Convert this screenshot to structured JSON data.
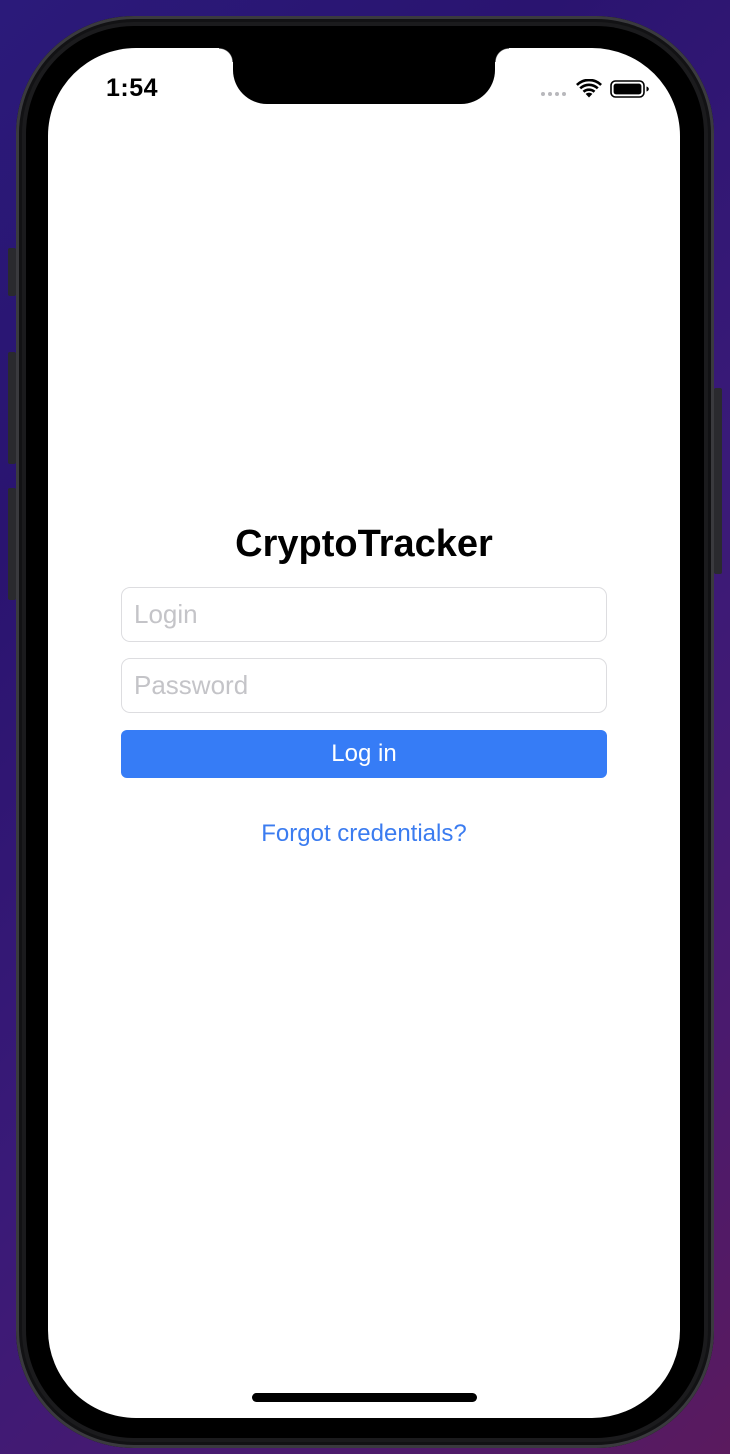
{
  "status_bar": {
    "time": "1:54",
    "signal_icon": "signal-dots-icon",
    "wifi_icon": "wifi-icon",
    "battery_icon": "battery-icon"
  },
  "login_screen": {
    "app_title": "CryptoTracker",
    "login_placeholder": "Login",
    "login_value": "",
    "password_placeholder": "Password",
    "password_value": "",
    "login_button_label": "Log in",
    "forgot_link_label": "Forgot credentials?"
  },
  "colors": {
    "primary_button": "#367cf6",
    "link": "#3b7cf0",
    "field_border": "#dddde0",
    "placeholder": "#c4c4c8",
    "screen_background": "#ffffff"
  }
}
